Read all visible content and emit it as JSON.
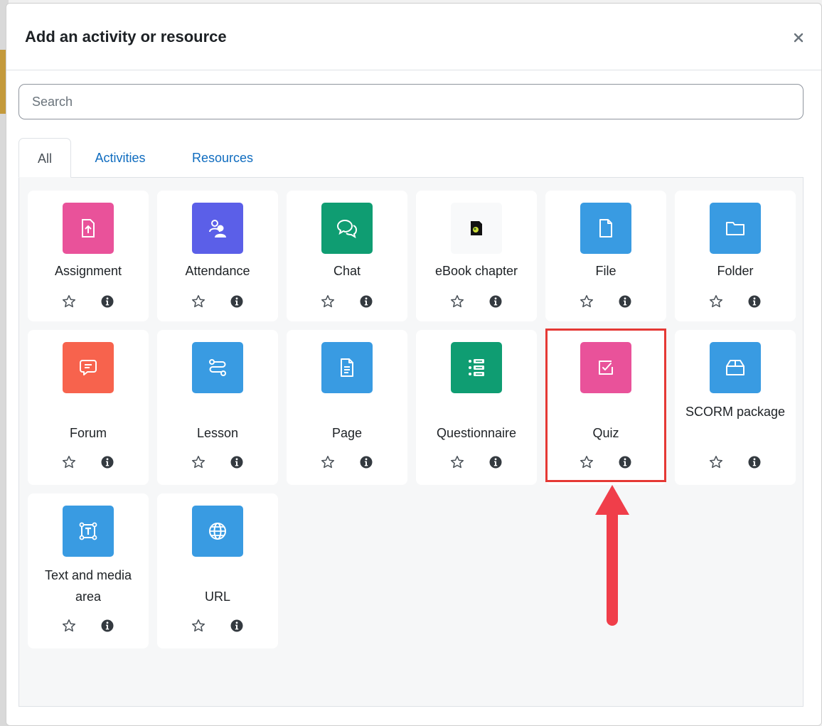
{
  "modal": {
    "title": "Add an activity or resource",
    "close_icon": "close-icon"
  },
  "search": {
    "placeholder": "Search",
    "value": ""
  },
  "tabs": [
    {
      "label": "All",
      "active": true
    },
    {
      "label": "Activities",
      "active": false
    },
    {
      "label": "Resources",
      "active": false
    }
  ],
  "items": [
    {
      "label": "Assignment",
      "icon": "assignment-icon",
      "color": "#e9529a"
    },
    {
      "label": "Attendance",
      "icon": "attendance-icon",
      "color": "#5b5fe8"
    },
    {
      "label": "Chat",
      "icon": "chat-icon",
      "color": "#0f9d72"
    },
    {
      "label": "eBook chapter",
      "icon": "ebook-chapter-icon",
      "color": "#f8f9fa"
    },
    {
      "label": "File",
      "icon": "file-icon",
      "color": "#399be2"
    },
    {
      "label": "Folder",
      "icon": "folder-icon",
      "color": "#399be2"
    },
    {
      "label": "Forum",
      "icon": "forum-icon",
      "color": "#f7634d"
    },
    {
      "label": "Lesson",
      "icon": "lesson-icon",
      "color": "#399be2"
    },
    {
      "label": "Page",
      "icon": "page-icon",
      "color": "#399be2"
    },
    {
      "label": "Questionnaire",
      "icon": "questionnaire-icon",
      "color": "#0f9d72"
    },
    {
      "label": "Quiz",
      "icon": "quiz-icon",
      "color": "#e9529a"
    },
    {
      "label": "SCORM package",
      "icon": "scorm-package-icon",
      "color": "#399be2"
    },
    {
      "label": "Text and media area",
      "icon": "text-and-media-icon",
      "color": "#399be2"
    },
    {
      "label": "URL",
      "icon": "url-icon",
      "color": "#399be2"
    }
  ],
  "item_actions": {
    "star_icon": "star-icon",
    "info_icon": "info-icon"
  },
  "annotation": {
    "highlight_target": "Quiz",
    "color": "#e53935"
  }
}
